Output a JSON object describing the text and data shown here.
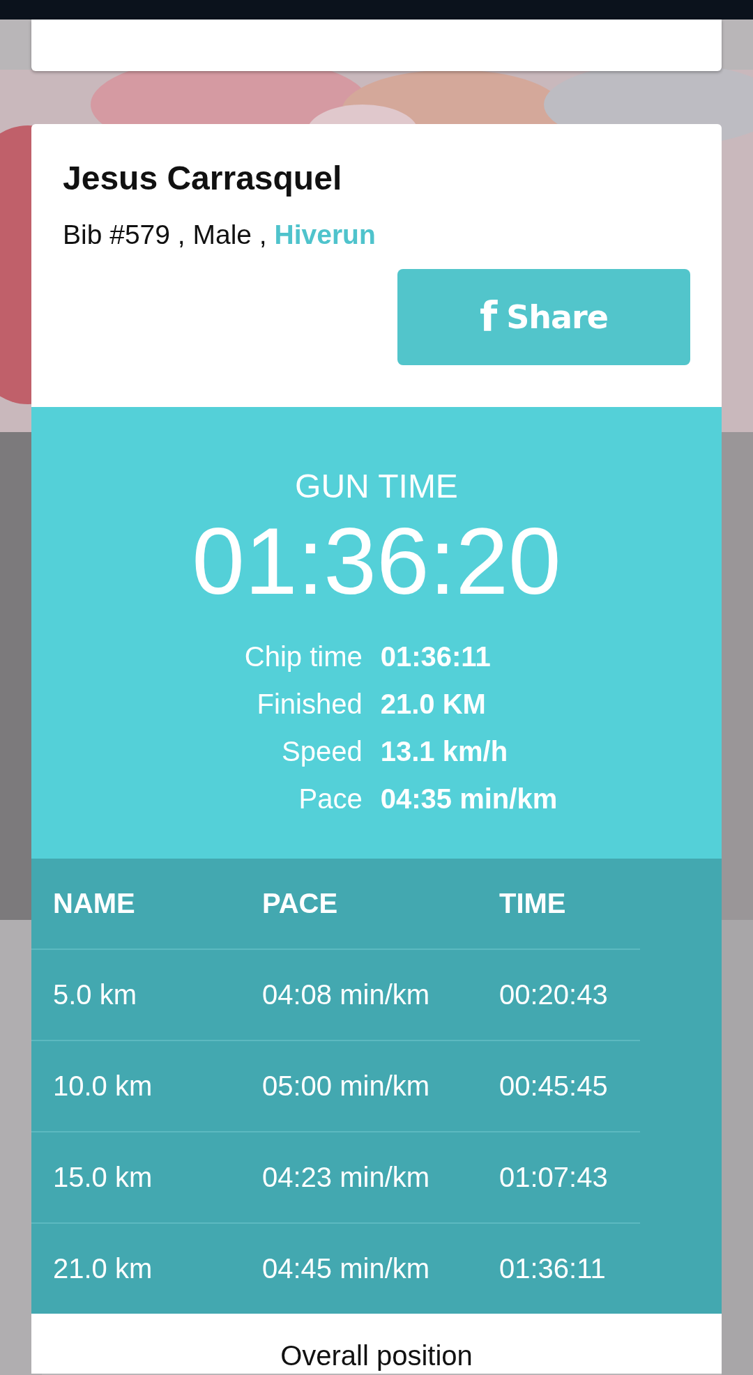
{
  "runner": {
    "name": "Jesus Carrasquel",
    "details": "Bib #579 , Male ,",
    "team_link": "Hiverun"
  },
  "share_button": {
    "icon": "f",
    "label": "Share"
  },
  "summary": {
    "title": "GUN TIME",
    "time": "01:36:20",
    "stats": [
      {
        "label": "Chip time",
        "value": "01:36:11"
      },
      {
        "label": "Finished",
        "value": "21.0 KM"
      },
      {
        "label": "Speed",
        "value": "13.1 km/h"
      },
      {
        "label": "Pace",
        "value": "04:35 min/km"
      }
    ]
  },
  "splits": {
    "columns": [
      "NAME",
      "PACE",
      "TIME"
    ],
    "rows": [
      [
        "5.0 km",
        "04:08 min/km",
        "00:20:43"
      ],
      [
        "10.0 km",
        "05:00 min/km",
        "00:45:45"
      ],
      [
        "15.0 km",
        "04:23 min/km",
        "01:07:43"
      ],
      [
        "21.0 km",
        "04:45 min/km",
        "01:36:11"
      ]
    ]
  },
  "next_section": {
    "title": "Overall position"
  }
}
